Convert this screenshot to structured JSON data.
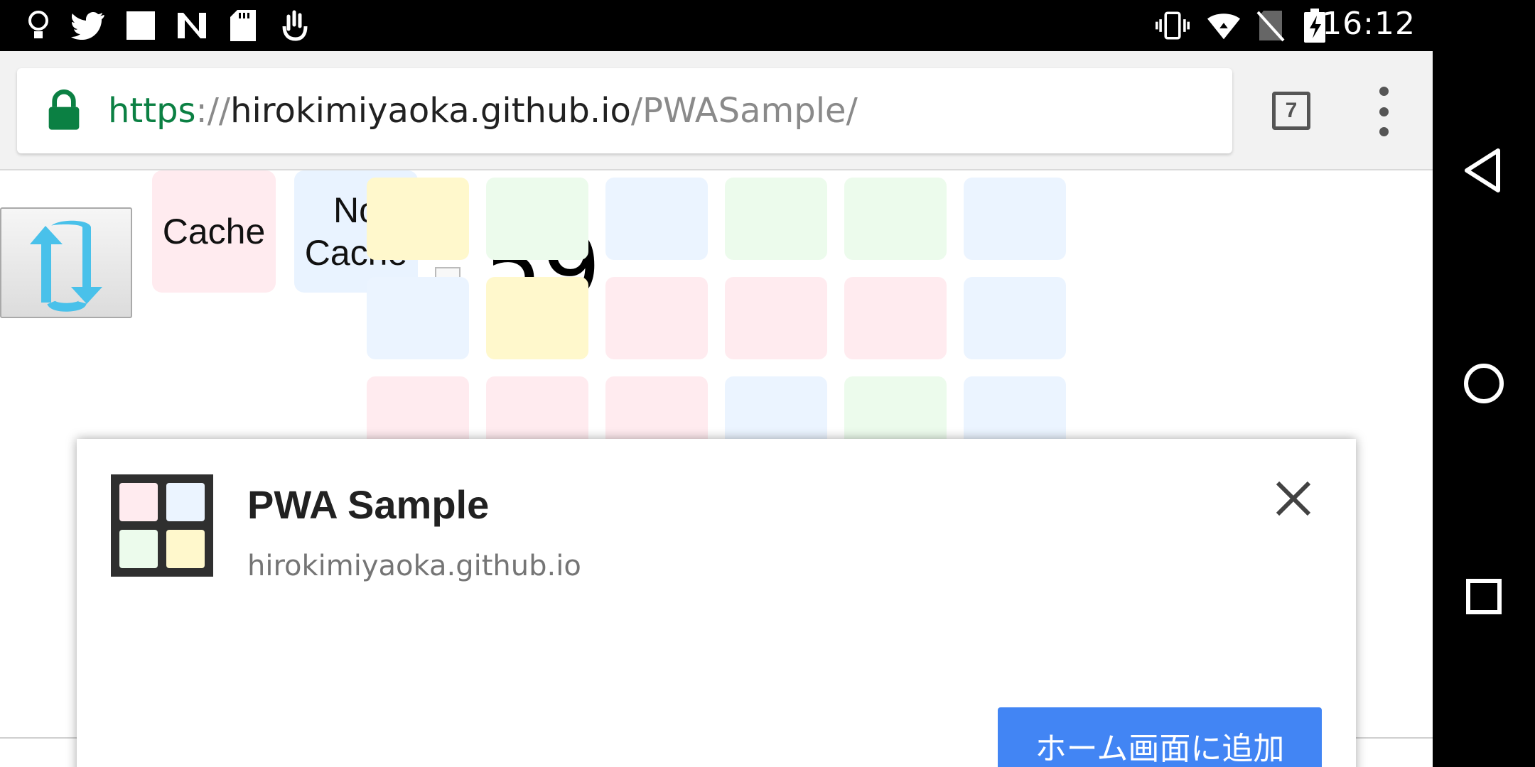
{
  "status_bar": {
    "time": "16:12",
    "left_icons": [
      "lightbulb-icon",
      "twitter-icon",
      "square-icon",
      "n-icon",
      "sd-card-icon",
      "hand-icon"
    ],
    "right_icons": [
      "vibrate-icon",
      "wifi-icon",
      "no-sim-icon",
      "battery-charging-icon"
    ]
  },
  "browser": {
    "url": {
      "scheme": "https",
      "separator": "://",
      "host": "hirokimiyaoka.github.io",
      "path": "/PWASample/"
    },
    "tab_count": "7"
  },
  "page": {
    "cache_label": "Cache",
    "nocache_label": "No Cache",
    "number_fragment": "59",
    "grid_colors": [
      [
        "#fff8cc",
        "#ecfbec",
        "#ebf4ff",
        "#ecfbec",
        "#ecfbec",
        "#ebf4ff"
      ],
      [
        "#ebf4ff",
        "#fff8cc",
        "#ffebef",
        "#ffebef",
        "#ffebef",
        "#ebf4ff"
      ],
      [
        "#ffebef",
        "#ffebef",
        "#ffebef",
        "#ebf4ff",
        "#ecfbec",
        "#ebf4ff"
      ]
    ]
  },
  "dialog": {
    "app_name": "PWA Sample",
    "origin": "hirokimiyaoka.github.io",
    "add_button_label": "ホーム画面に追加",
    "icon_colors": [
      "#ffebef",
      "#ebf4ff",
      "#ecfbec",
      "#fff8cc"
    ]
  },
  "colors": {
    "accent": "#4285f4",
    "secure_green": "#0b8043"
  }
}
